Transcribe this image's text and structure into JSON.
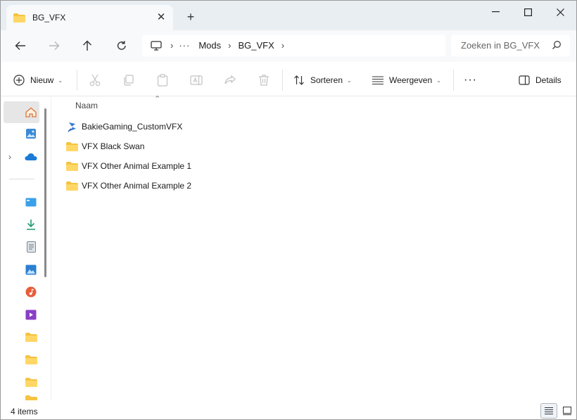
{
  "window": {
    "tab_title": "BG_VFX",
    "new_tab": "+"
  },
  "address": {
    "segments": [
      "Mods",
      "BG_VFX"
    ],
    "search_placeholder": "Zoeken in BG_VFX"
  },
  "commands": {
    "new_label": "Nieuw",
    "sort_label": "Sorteren",
    "view_label": "Weergeven",
    "more_label": "···",
    "details_label": "Details"
  },
  "content": {
    "column_header": "Naam",
    "items": [
      {
        "name": "BakieGaming_CustomVFX",
        "icon": "shortcut-icon"
      },
      {
        "name": "VFX Black Swan",
        "icon": "folder-icon"
      },
      {
        "name": "VFX Other Animal Example 1",
        "icon": "folder-icon"
      },
      {
        "name": "VFX Other Animal Example 2",
        "icon": "folder-icon"
      }
    ]
  },
  "status": {
    "item_count": "4 items"
  },
  "colors": {
    "folder": "#f5c342",
    "accent": "#0067c0"
  }
}
